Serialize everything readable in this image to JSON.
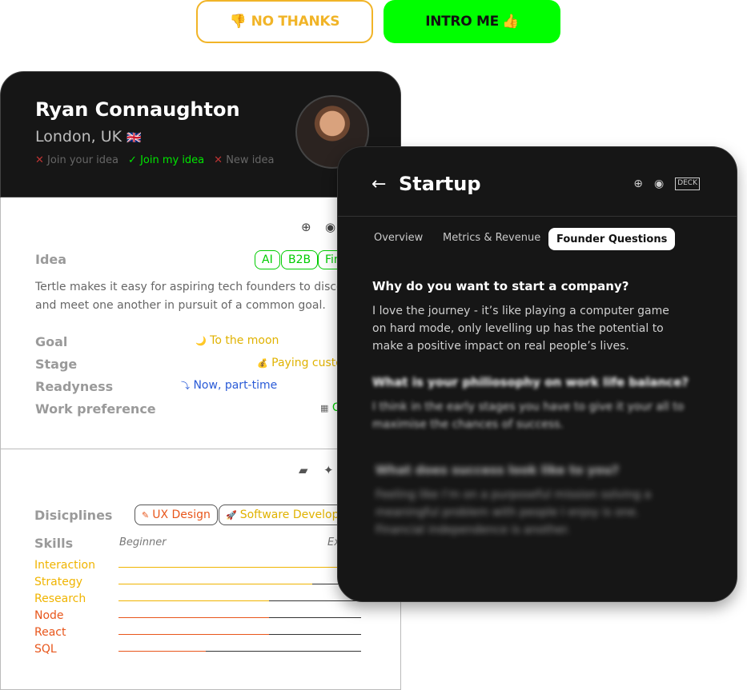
{
  "actions": {
    "no_thanks": "NO THANKS",
    "no_thanks_icon": "👎",
    "intro_me": "INTRO ME",
    "intro_me_icon": "👍"
  },
  "profile": {
    "name": "Ryan Connaughton",
    "location": "London, UK",
    "flag_icon": "🇬🇧",
    "tags": [
      {
        "mark": "✕",
        "label": "Join your idea"
      },
      {
        "mark": "✓",
        "label": "Join my idea"
      },
      {
        "mark": "✕",
        "label": "New idea"
      }
    ],
    "idea": {
      "label": "Idea",
      "pills": [
        "AI",
        "B2B",
        "Fin"
      ],
      "description": "Tertle makes it easy for aspiring tech founders to discov and meet one another in pursuit of a common goal."
    },
    "fields": [
      {
        "label": "Goal",
        "value": "To the moon",
        "icon": "🌙"
      },
      {
        "label": "Stage",
        "value": "Paying custo",
        "icon": "💰"
      },
      {
        "label": "Readyness",
        "value": "Now, part-time",
        "icon": "⤵"
      },
      {
        "label": "Work preference",
        "value": "C",
        "icon": "▦"
      }
    ],
    "disciplines": {
      "label": "Disciplines",
      "label_text": "Disicplines",
      "items": [
        "UX Design",
        "Software Developm"
      ],
      "item_icons": [
        "✎",
        "🚀"
      ]
    },
    "skills": {
      "label": "Skills",
      "scale_min": "Beginner",
      "scale_max": "Ex",
      "items": [
        {
          "name": "Interaction",
          "level": 0.9,
          "color": "#f0b400"
        },
        {
          "name": "Strategy",
          "level": 0.8,
          "color": "#f0b400"
        },
        {
          "name": "Research",
          "level": 0.62,
          "color": "#f0b400"
        },
        {
          "name": "Node",
          "level": 0.62,
          "color": "#e8561b"
        },
        {
          "name": "React",
          "level": 0.62,
          "color": "#e8561b"
        },
        {
          "name": "SQL",
          "level": 0.36,
          "color": "#e8561b"
        }
      ]
    }
  },
  "startup": {
    "title": "Startup",
    "back_icon": "←",
    "icons": [
      "globe-icon",
      "github-icon",
      "deck-icon"
    ],
    "tabs": {
      "overview": "Overview",
      "metrics": "Metrics & Revenue",
      "founder": "Founder Questions"
    },
    "qa": [
      {
        "question": "Why do you want to start a company?",
        "answer": "I love the journey - it’s like playing a computer game on hard mode, only levelling up has the potential to make a positive impact on real people’s lives."
      },
      {
        "question": "What is your philiosophy on work life balance?",
        "answer": "I think in the early stages you have to give it your all to maximise the chances of success."
      },
      {
        "question": "What does success look like to you?",
        "answer": "Feeling like I’m on a purposeful mission solving a meaningful problem with people I enjoy is one. Financial independence is another."
      }
    ]
  }
}
